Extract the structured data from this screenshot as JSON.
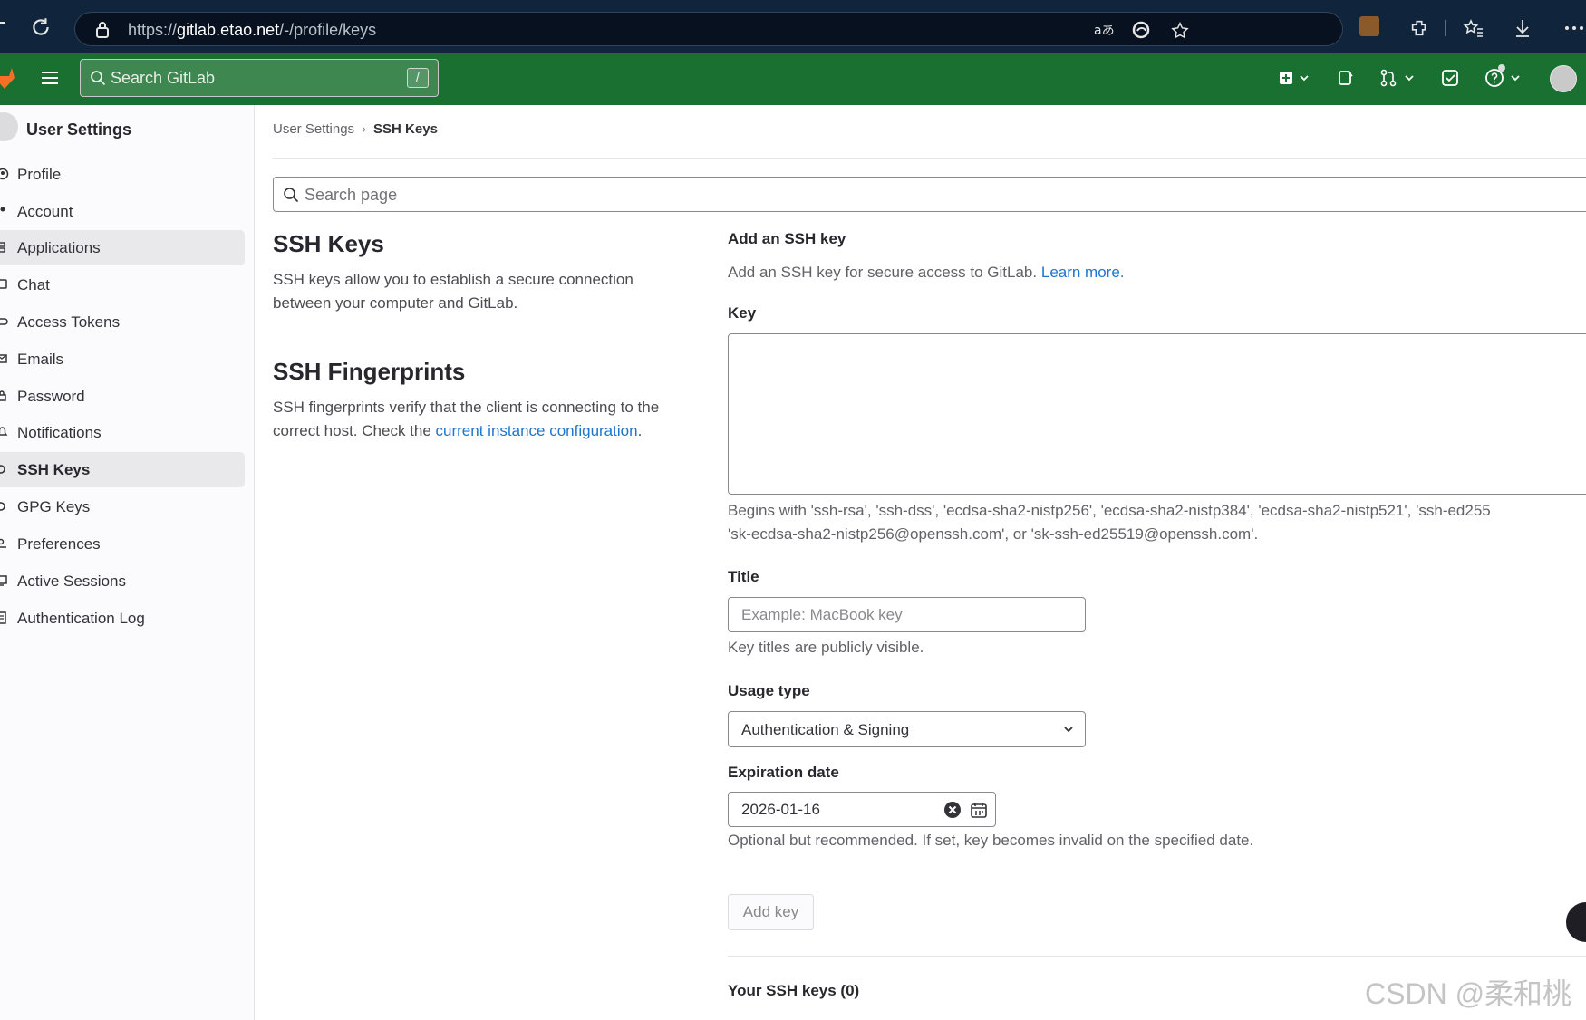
{
  "browser": {
    "url_prefix": "https://",
    "url_host": "gitlab.etao.net",
    "url_path": "/-/profile/keys"
  },
  "header": {
    "search_placeholder": "Search GitLab",
    "search_shortcut": "/",
    "brand_color": "#1a7030"
  },
  "sidebar": {
    "title": "User Settings",
    "items": [
      {
        "label": "Profile",
        "icon": "profile-icon"
      },
      {
        "label": "Account",
        "icon": "account-icon"
      },
      {
        "label": "Applications",
        "icon": "applications-icon"
      },
      {
        "label": "Chat",
        "icon": "chat-icon"
      },
      {
        "label": "Access Tokens",
        "icon": "token-icon"
      },
      {
        "label": "Emails",
        "icon": "mail-icon"
      },
      {
        "label": "Password",
        "icon": "lock-icon"
      },
      {
        "label": "Notifications",
        "icon": "bell-icon"
      },
      {
        "label": "SSH Keys",
        "icon": "key-icon"
      },
      {
        "label": "GPG Keys",
        "icon": "key-icon"
      },
      {
        "label": "Preferences",
        "icon": "preferences-icon"
      },
      {
        "label": "Active Sessions",
        "icon": "monitor-icon"
      },
      {
        "label": "Authentication Log",
        "icon": "log-icon"
      }
    ]
  },
  "breadcrumb": {
    "parent": "User Settings",
    "separator": "›",
    "current": "SSH Keys"
  },
  "page_search": {
    "placeholder": "Search page"
  },
  "ssh_keys": {
    "title": "SSH Keys",
    "description": "SSH keys allow you to establish a secure connection between your computer and GitLab."
  },
  "fingerprints": {
    "title": "SSH Fingerprints",
    "description_before": "SSH fingerprints verify that the client is connecting to the correct host. Check the ",
    "link_text": "current instance configuration",
    "description_after": "."
  },
  "form": {
    "heading": "Add an SSH key",
    "intro": "Add an SSH key for secure access to GitLab.",
    "intro_link": "Learn more.",
    "key_label": "Key",
    "key_hint_line1": "Begins with 'ssh-rsa', 'ssh-dss', 'ecdsa-sha2-nistp256', 'ecdsa-sha2-nistp384', 'ecdsa-sha2-nistp521', 'ssh-ed255",
    "key_hint_line2": "'sk-ecdsa-sha2-nistp256@openssh.com', or 'sk-ssh-ed25519@openssh.com'.",
    "title_label": "Title",
    "title_placeholder": "Example: MacBook key",
    "title_hint": "Key titles are publicly visible.",
    "usage_label": "Usage type",
    "usage_value": "Authentication & Signing",
    "expiration_label": "Expiration date",
    "expiration_value": "2026-01-16",
    "expiration_hint": "Optional but recommended. If set, key becomes invalid on the specified date.",
    "submit_label": "Add key"
  },
  "keys_list": {
    "heading": "Your SSH keys (0)"
  },
  "watermark": "CSDN @柔和桃"
}
